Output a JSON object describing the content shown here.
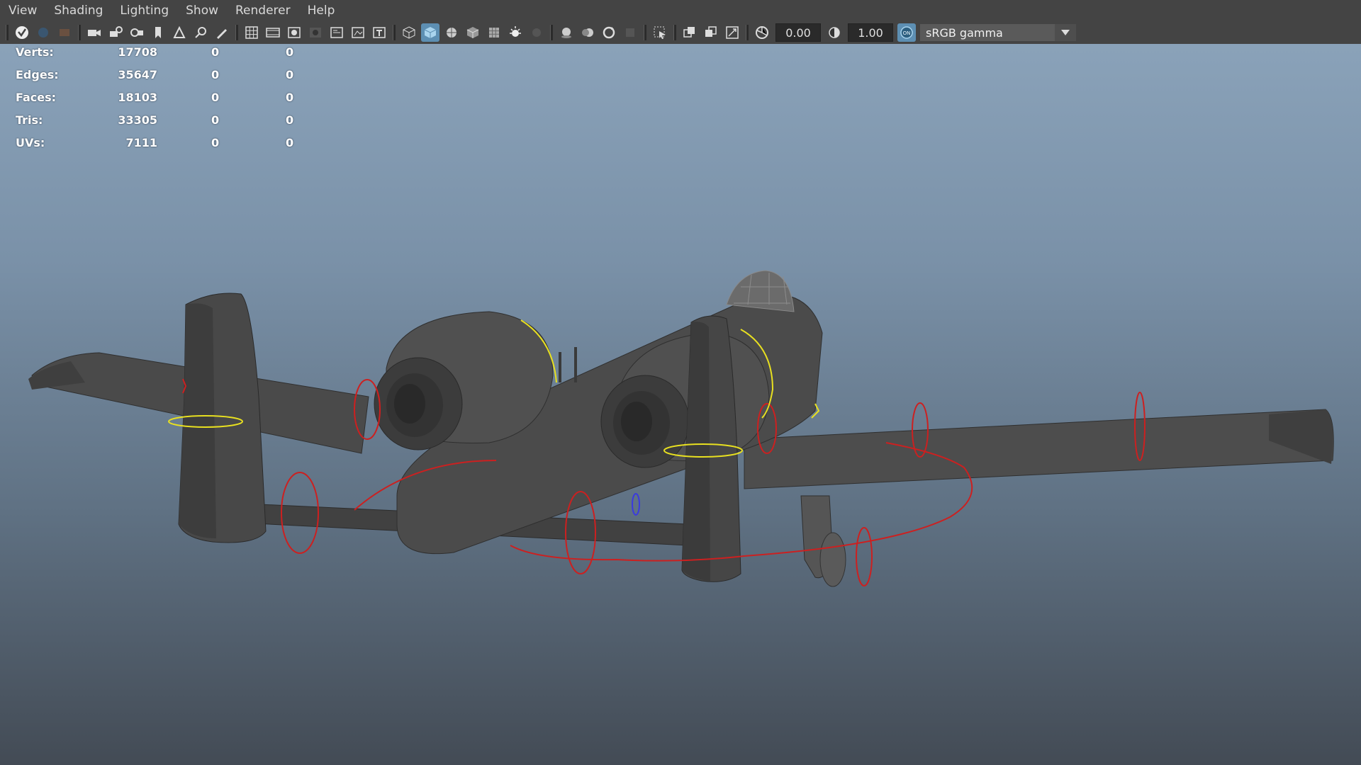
{
  "menu": [
    "View",
    "Shading",
    "Lighting",
    "Show",
    "Renderer",
    "Help"
  ],
  "toolbar": {
    "exposure_value": "0.00",
    "gamma_value": "1.00",
    "color_space": "sRGB gamma",
    "icons": [
      "select-camera-icon",
      "camera-icon",
      "camera-lock-icon",
      "camera-attributes-icon",
      "bookmark-icon",
      "image-plane-icon",
      "2d-pan-zoom-icon",
      "grease-pencil-icon",
      "grid-icon",
      "film-gate-icon",
      "resolution-gate-icon",
      "gate-mask-icon",
      "field-chart-icon",
      "safe-action-icon",
      "safe-title-icon",
      "wireframe-icon",
      "smooth-shade-icon",
      "wireframe-on-shaded-icon",
      "xray-icon",
      "use-default-material-icon",
      "lights-icon",
      "shadows-icon",
      "screen-space-ao-icon",
      "motion-blur-icon",
      "anti-aliasing-icon",
      "depth-of-field-icon",
      "isolate-select-icon",
      "xray-joints-icon",
      "xray-active-icon",
      "backface-icon",
      "exposure-icon",
      "gamma-icon",
      "color-management-icon",
      "dropdown-chevron-icon"
    ]
  },
  "hud": {
    "rows": [
      {
        "label": "Verts:",
        "v1": "17708",
        "v2": "0",
        "v3": "0"
      },
      {
        "label": "Edges:",
        "v1": "35647",
        "v2": "0",
        "v3": "0"
      },
      {
        "label": "Faces:",
        "v1": "18103",
        "v2": "0",
        "v3": "0"
      },
      {
        "label": "Tris:",
        "v1": "33305",
        "v2": "0",
        "v3": "0"
      },
      {
        "label": "UVs:",
        "v1": "7111",
        "v2": "0",
        "v3": "0"
      }
    ]
  },
  "colors": {
    "model": "#4a4a4a",
    "control_curve_red": "#cc2020",
    "control_curve_yellow": "#e8e020",
    "accent": "#5d8fb3"
  }
}
